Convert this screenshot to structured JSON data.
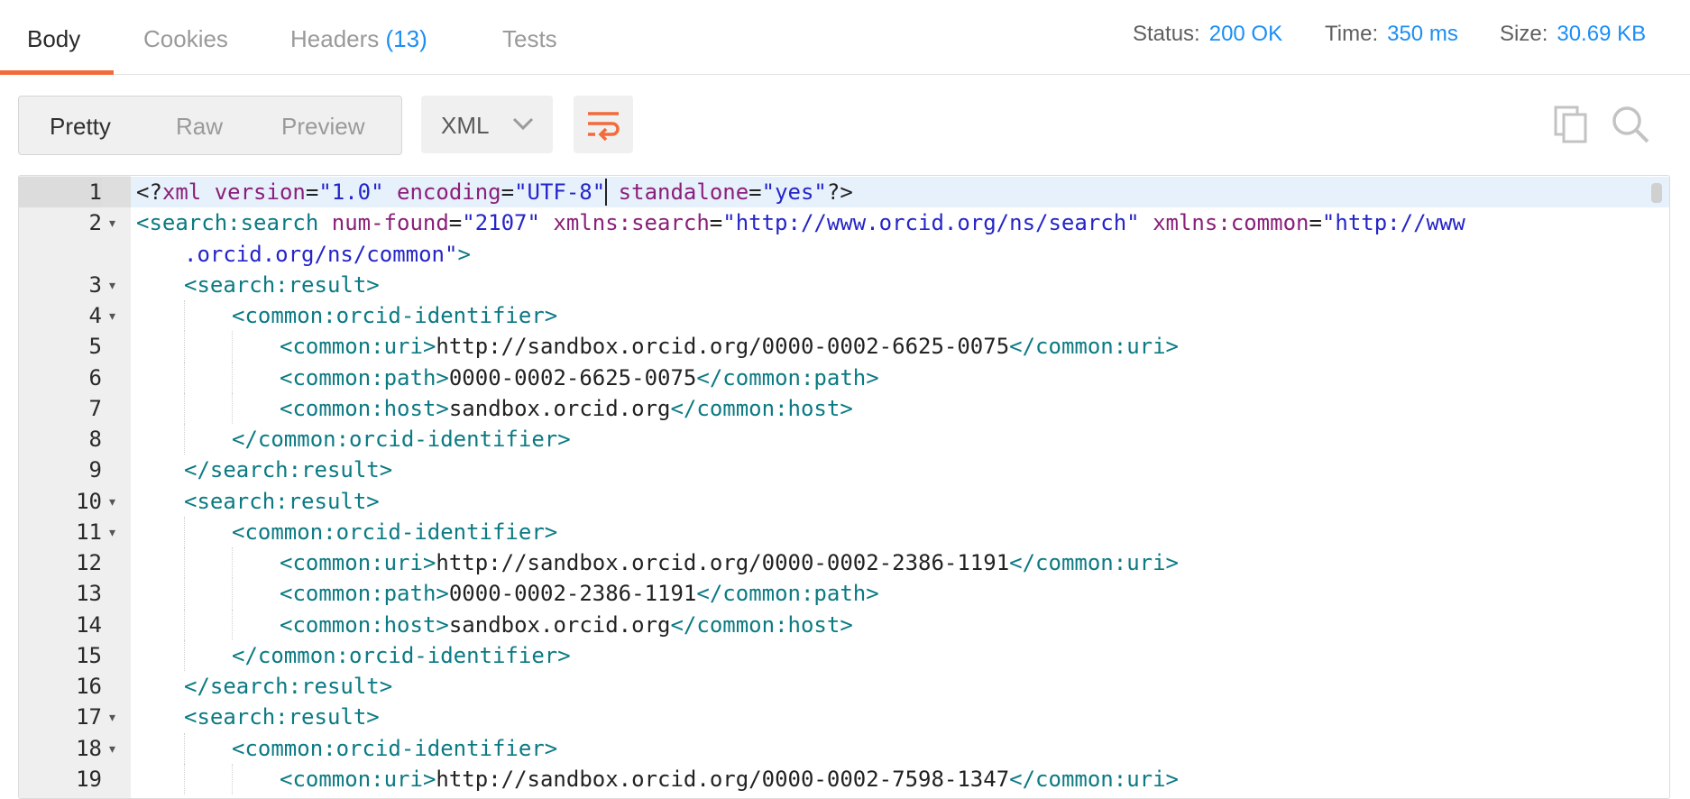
{
  "tabs": [
    {
      "label": "Body",
      "active": true
    },
    {
      "label": "Cookies"
    },
    {
      "label": "Headers ",
      "count": "(13)"
    },
    {
      "label": "Tests"
    }
  ],
  "status": {
    "status_label": "Status:",
    "status_value": "200 OK",
    "time_label": "Time:",
    "time_value": "350 ms",
    "size_label": "Size:",
    "size_value": "30.69 KB"
  },
  "view_modes": [
    "Pretty",
    "Raw",
    "Preview"
  ],
  "format": {
    "selected": "XML"
  },
  "icons": {
    "wrap": "wrap-lines-icon",
    "copy": "copy-icon",
    "search": "search-icon",
    "chevron": "chevron-down-icon"
  },
  "colors": {
    "accent": "#f26b3a",
    "link": "#1b8ef5",
    "tag": "#0b7a83",
    "attr": "#8a1f7a",
    "value": "#2525c8"
  },
  "editor": {
    "lines": [
      {
        "n": "1",
        "fold": false,
        "indent": 0,
        "tokens": [
          [
            "pl",
            "<?"
          ],
          [
            "attr",
            "xml "
          ],
          [
            "attr",
            "version"
          ],
          [
            "pl",
            "="
          ],
          [
            "val",
            "\"1.0\""
          ],
          [
            "pl",
            " "
          ],
          [
            "attr",
            "encoding"
          ],
          [
            "pl",
            "="
          ],
          [
            "val",
            "\"UTF-8\""
          ],
          [
            "pl",
            " "
          ],
          [
            "attr",
            "standalone"
          ],
          [
            "pl",
            "="
          ],
          [
            "val",
            "\"yes\""
          ],
          [
            "pl",
            "?>"
          ]
        ]
      },
      {
        "n": "2",
        "fold": true,
        "indent": 0,
        "tokens": [
          [
            "tag",
            "<search:search "
          ],
          [
            "attr",
            "num-found"
          ],
          [
            "pl",
            "="
          ],
          [
            "val",
            "\"2107\""
          ],
          [
            "pl",
            " "
          ],
          [
            "attr",
            "xmlns:search"
          ],
          [
            "pl",
            "="
          ],
          [
            "val",
            "\"http://www.orcid.org/ns/search\""
          ],
          [
            "pl",
            " "
          ],
          [
            "attr",
            "xmlns:common"
          ],
          [
            "pl",
            "="
          ],
          [
            "val",
            "\"http://www"
          ]
        ]
      },
      {
        "n": "",
        "fold": false,
        "indent": 1,
        "tokens": [
          [
            "val",
            ".orcid.org/ns/common\""
          ],
          [
            "tag",
            ">"
          ]
        ]
      },
      {
        "n": "3",
        "fold": true,
        "indent": 1,
        "tokens": [
          [
            "tag",
            "<search:result>"
          ]
        ]
      },
      {
        "n": "4",
        "fold": true,
        "indent": 2,
        "tokens": [
          [
            "tag",
            "<common:orcid-identifier>"
          ]
        ]
      },
      {
        "n": "5",
        "fold": false,
        "indent": 3,
        "tokens": [
          [
            "tag",
            "<common:uri>"
          ],
          [
            "pl",
            "http://sandbox.orcid.org/0000-0002-6625-0075"
          ],
          [
            "tag",
            "</common:uri>"
          ]
        ]
      },
      {
        "n": "6",
        "fold": false,
        "indent": 3,
        "tokens": [
          [
            "tag",
            "<common:path>"
          ],
          [
            "pl",
            "0000-0002-6625-0075"
          ],
          [
            "tag",
            "</common:path>"
          ]
        ]
      },
      {
        "n": "7",
        "fold": false,
        "indent": 3,
        "tokens": [
          [
            "tag",
            "<common:host>"
          ],
          [
            "pl",
            "sandbox.orcid.org"
          ],
          [
            "tag",
            "</common:host>"
          ]
        ]
      },
      {
        "n": "8",
        "fold": false,
        "indent": 2,
        "tokens": [
          [
            "tag",
            "</common:orcid-identifier>"
          ]
        ]
      },
      {
        "n": "9",
        "fold": false,
        "indent": 1,
        "tokens": [
          [
            "tag",
            "</search:result>"
          ]
        ]
      },
      {
        "n": "10",
        "fold": true,
        "indent": 1,
        "tokens": [
          [
            "tag",
            "<search:result>"
          ]
        ]
      },
      {
        "n": "11",
        "fold": true,
        "indent": 2,
        "tokens": [
          [
            "tag",
            "<common:orcid-identifier>"
          ]
        ]
      },
      {
        "n": "12",
        "fold": false,
        "indent": 3,
        "tokens": [
          [
            "tag",
            "<common:uri>"
          ],
          [
            "pl",
            "http://sandbox.orcid.org/0000-0002-2386-1191"
          ],
          [
            "tag",
            "</common:uri>"
          ]
        ]
      },
      {
        "n": "13",
        "fold": false,
        "indent": 3,
        "tokens": [
          [
            "tag",
            "<common:path>"
          ],
          [
            "pl",
            "0000-0002-2386-1191"
          ],
          [
            "tag",
            "</common:path>"
          ]
        ]
      },
      {
        "n": "14",
        "fold": false,
        "indent": 3,
        "tokens": [
          [
            "tag",
            "<common:host>"
          ],
          [
            "pl",
            "sandbox.orcid.org"
          ],
          [
            "tag",
            "</common:host>"
          ]
        ]
      },
      {
        "n": "15",
        "fold": false,
        "indent": 2,
        "tokens": [
          [
            "tag",
            "</common:orcid-identifier>"
          ]
        ]
      },
      {
        "n": "16",
        "fold": false,
        "indent": 1,
        "tokens": [
          [
            "tag",
            "</search:result>"
          ]
        ]
      },
      {
        "n": "17",
        "fold": true,
        "indent": 1,
        "tokens": [
          [
            "tag",
            "<search:result>"
          ]
        ]
      },
      {
        "n": "18",
        "fold": true,
        "indent": 2,
        "tokens": [
          [
            "tag",
            "<common:orcid-identifier>"
          ]
        ]
      },
      {
        "n": "19",
        "fold": false,
        "indent": 3,
        "tokens": [
          [
            "tag",
            "<common:uri>"
          ],
          [
            "pl",
            "http://sandbox.orcid.org/0000-0002-7598-1347"
          ],
          [
            "tag",
            "</common:uri>"
          ]
        ]
      }
    ]
  }
}
